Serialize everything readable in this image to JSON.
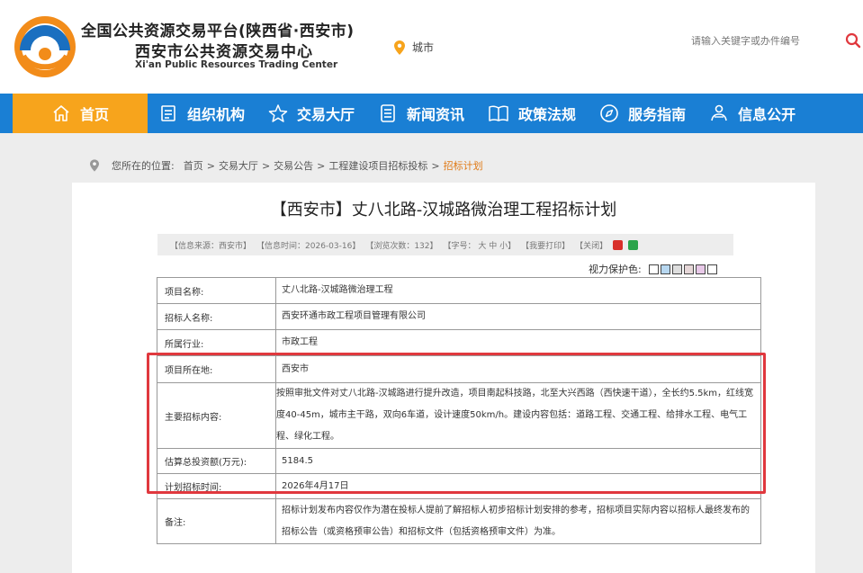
{
  "header": {
    "title_line1": "全国公共资源交易平台(陕西省·西安市)",
    "title_line2": "西安市公共资源交易中心",
    "title_en": "Xi'an Public Resources Trading Center",
    "city_label": "城市",
    "search_placeholder": "请输入关键字或办件编号"
  },
  "nav": {
    "items": [
      {
        "label": "首页",
        "icon": "home-icon"
      },
      {
        "label": "组织机构",
        "icon": "org-doc-icon"
      },
      {
        "label": "交易大厅",
        "icon": "star-icon"
      },
      {
        "label": "新闻资讯",
        "icon": "news-icon"
      },
      {
        "label": "政策法规",
        "icon": "book-icon"
      },
      {
        "label": "服务指南",
        "icon": "compass-icon"
      },
      {
        "label": "信息公开",
        "icon": "person-icon"
      }
    ]
  },
  "breadcrumb": {
    "prefix": "您所在的位置:",
    "items": [
      "首页",
      "交易大厅",
      "交易公告",
      "工程建设项目招标投标"
    ],
    "current": "招标计划"
  },
  "article": {
    "title": "【西安市】丈八北路-汉城路微治理工程招标计划",
    "info_source": "【信息来源：西安市】",
    "info_time": "【信息时间：2026-03-16】",
    "info_views": "【浏览次数：132】",
    "info_fontsize": "【字号： 大 中 小】",
    "info_print": "【我要打印】",
    "info_close": "【关闭】",
    "vision_label": "视力保护色:",
    "vision_colors": [
      "#ffffff",
      "#b7d7f0",
      "#dedede",
      "#e6d7d8",
      "#e8c9e8",
      "#ffffff"
    ]
  },
  "table": {
    "rows": [
      {
        "label": "项目名称:",
        "value": "丈八北路-汉城路微治理工程"
      },
      {
        "label": "招标人名称:",
        "value": "西安环通市政工程项目管理有限公司"
      },
      {
        "label": "所属行业:",
        "value": "市政工程"
      },
      {
        "label": "项目所在地:",
        "value": "西安市"
      },
      {
        "label": "主要招标内容:",
        "value": "按照审批文件对丈八北路-汉城路进行提升改造，项目南起科技路，北至大兴西路（西快速干道），全长约5.5km，红线宽度40-45m，城市主干路，双向6车道，设计速度50km/h。建设内容包括：道路工程、交通工程、给排水工程、电气工程、绿化工程。"
      },
      {
        "label": "估算总投资额(万元):",
        "value": "5184.5"
      },
      {
        "label": "计划招标时间:",
        "value": "2026年4月17日"
      },
      {
        "label": "备注:",
        "value": "招标计划发布内容仅作为潜在投标人提前了解招标人初步招标计划安排的参考，招标项目实际内容以招标人最终发布的招标公告（或资格预审公告）和招标文件（包括资格预审文件）为准。"
      }
    ]
  }
}
